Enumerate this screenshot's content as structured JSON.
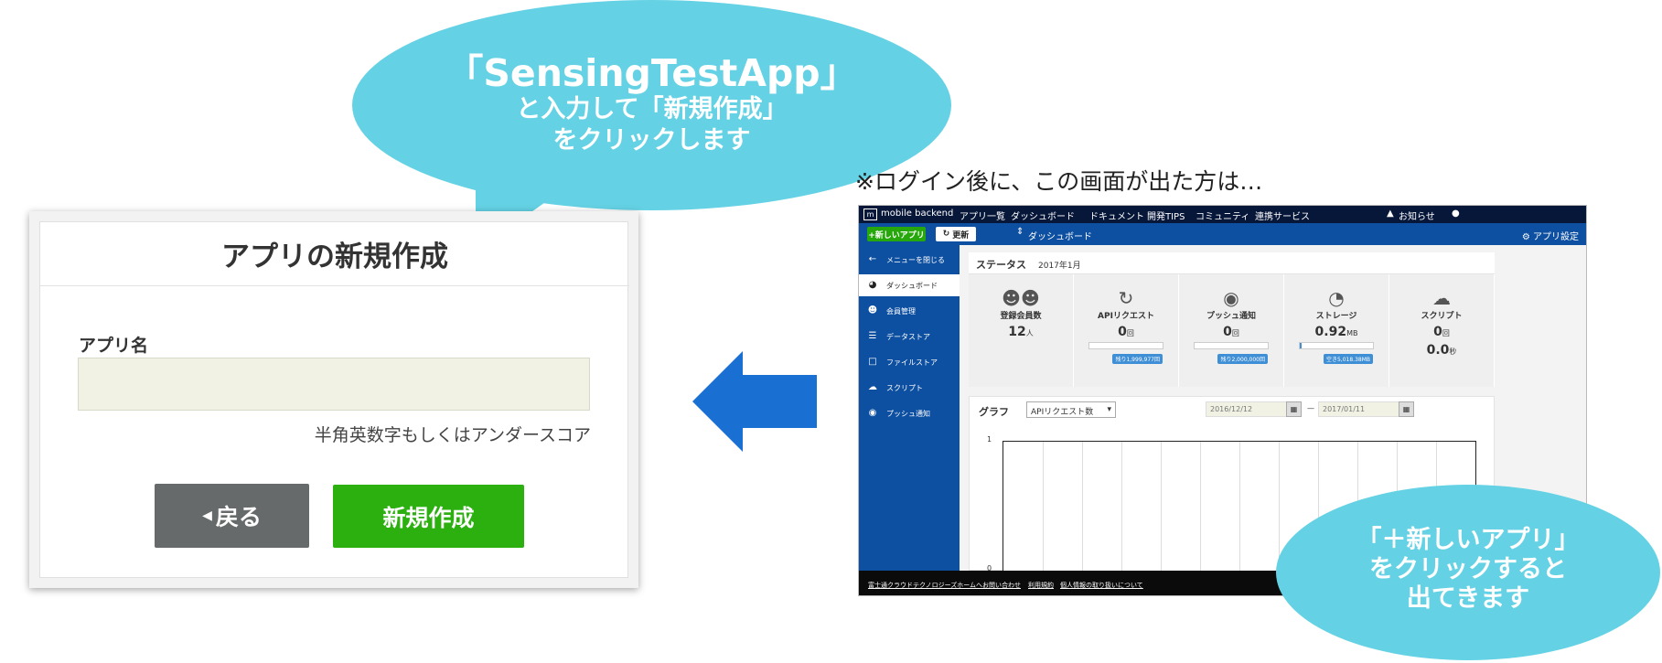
{
  "callout_top": {
    "line1": "「SensingTestApp」",
    "line2": "と入力して「新規作成」",
    "line3": "をクリックします"
  },
  "callout_bottom": {
    "line1": "「＋新しいアプリ」",
    "line2": "をクリックすると",
    "line3": "出てきます"
  },
  "note": "※ログイン後に、この画面が出た方は…",
  "dialog": {
    "title": "アプリの新規作成",
    "field_label": "アプリ名",
    "field_value": "",
    "hint": "半角英数字もしくはアンダースコア",
    "back_label": "戻る",
    "create_label": "新規作成"
  },
  "colors": {
    "bubble": "#64d2e4",
    "arrow": "#1a6fd3",
    "create_button": "#2cb010",
    "back_button": "#666a6b"
  },
  "screenshot": {
    "logo_text": "mobile backend",
    "nav": [
      "アプリ一覧",
      "ダッシュボード",
      "ドキュメント",
      "開発TIPS",
      "コミュニティ",
      "連携サービス"
    ],
    "notice": "お知らせ",
    "new_app_label": "+新しいアプリ",
    "reload_label": "更新",
    "breadcrumb": "ダッシュボード",
    "app_settings": "アプリ設定",
    "sidebar": [
      {
        "label": "メニューを閉じる",
        "icon": "back-arrow-icon",
        "active": false
      },
      {
        "label": "ダッシュボード",
        "icon": "dashboard-icon",
        "active": true
      },
      {
        "label": "会員管理",
        "icon": "users-icon",
        "active": false
      },
      {
        "label": "データストア",
        "icon": "datastore-icon",
        "active": false
      },
      {
        "label": "ファイルストア",
        "icon": "file-icon",
        "active": false
      },
      {
        "label": "スクリプト",
        "icon": "script-icon",
        "active": false
      },
      {
        "label": "プッシュ通知",
        "icon": "chat-icon",
        "active": false
      }
    ],
    "status_title": "ステータス",
    "status_date": "2017年1月",
    "stats": [
      {
        "label": "登録会員数",
        "value": "12",
        "unit": "人",
        "remaining": "",
        "gauge": null
      },
      {
        "label": "APIリクエスト",
        "value": "0",
        "unit": "回",
        "remaining": "残り1,999,977回",
        "gauge": 0
      },
      {
        "label": "プッシュ通知",
        "value": "0",
        "unit": "回",
        "remaining": "残り2,000,000回",
        "gauge": 0
      },
      {
        "label": "ストレージ",
        "value": "0.92",
        "unit": "MB",
        "remaining": "空き5,018.38MB",
        "gauge": 0.0002
      },
      {
        "label": "スクリプト",
        "value": "0",
        "unit": "回",
        "value2": "0.0",
        "unit2": "秒",
        "remaining": "",
        "gauge": null
      }
    ],
    "graph_title": "グラフ",
    "graph_select": "APIリクエスト数",
    "date_from": "2016/12/12",
    "date_sep": "—",
    "date_to": "2017/01/11",
    "y_max": "1",
    "y_min": "0",
    "footer_links": [
      "富士通クラウドテクノロジーズホームへ",
      "お問い合わせ",
      "利用規約",
      "個人情報の取り扱いについて"
    ]
  }
}
